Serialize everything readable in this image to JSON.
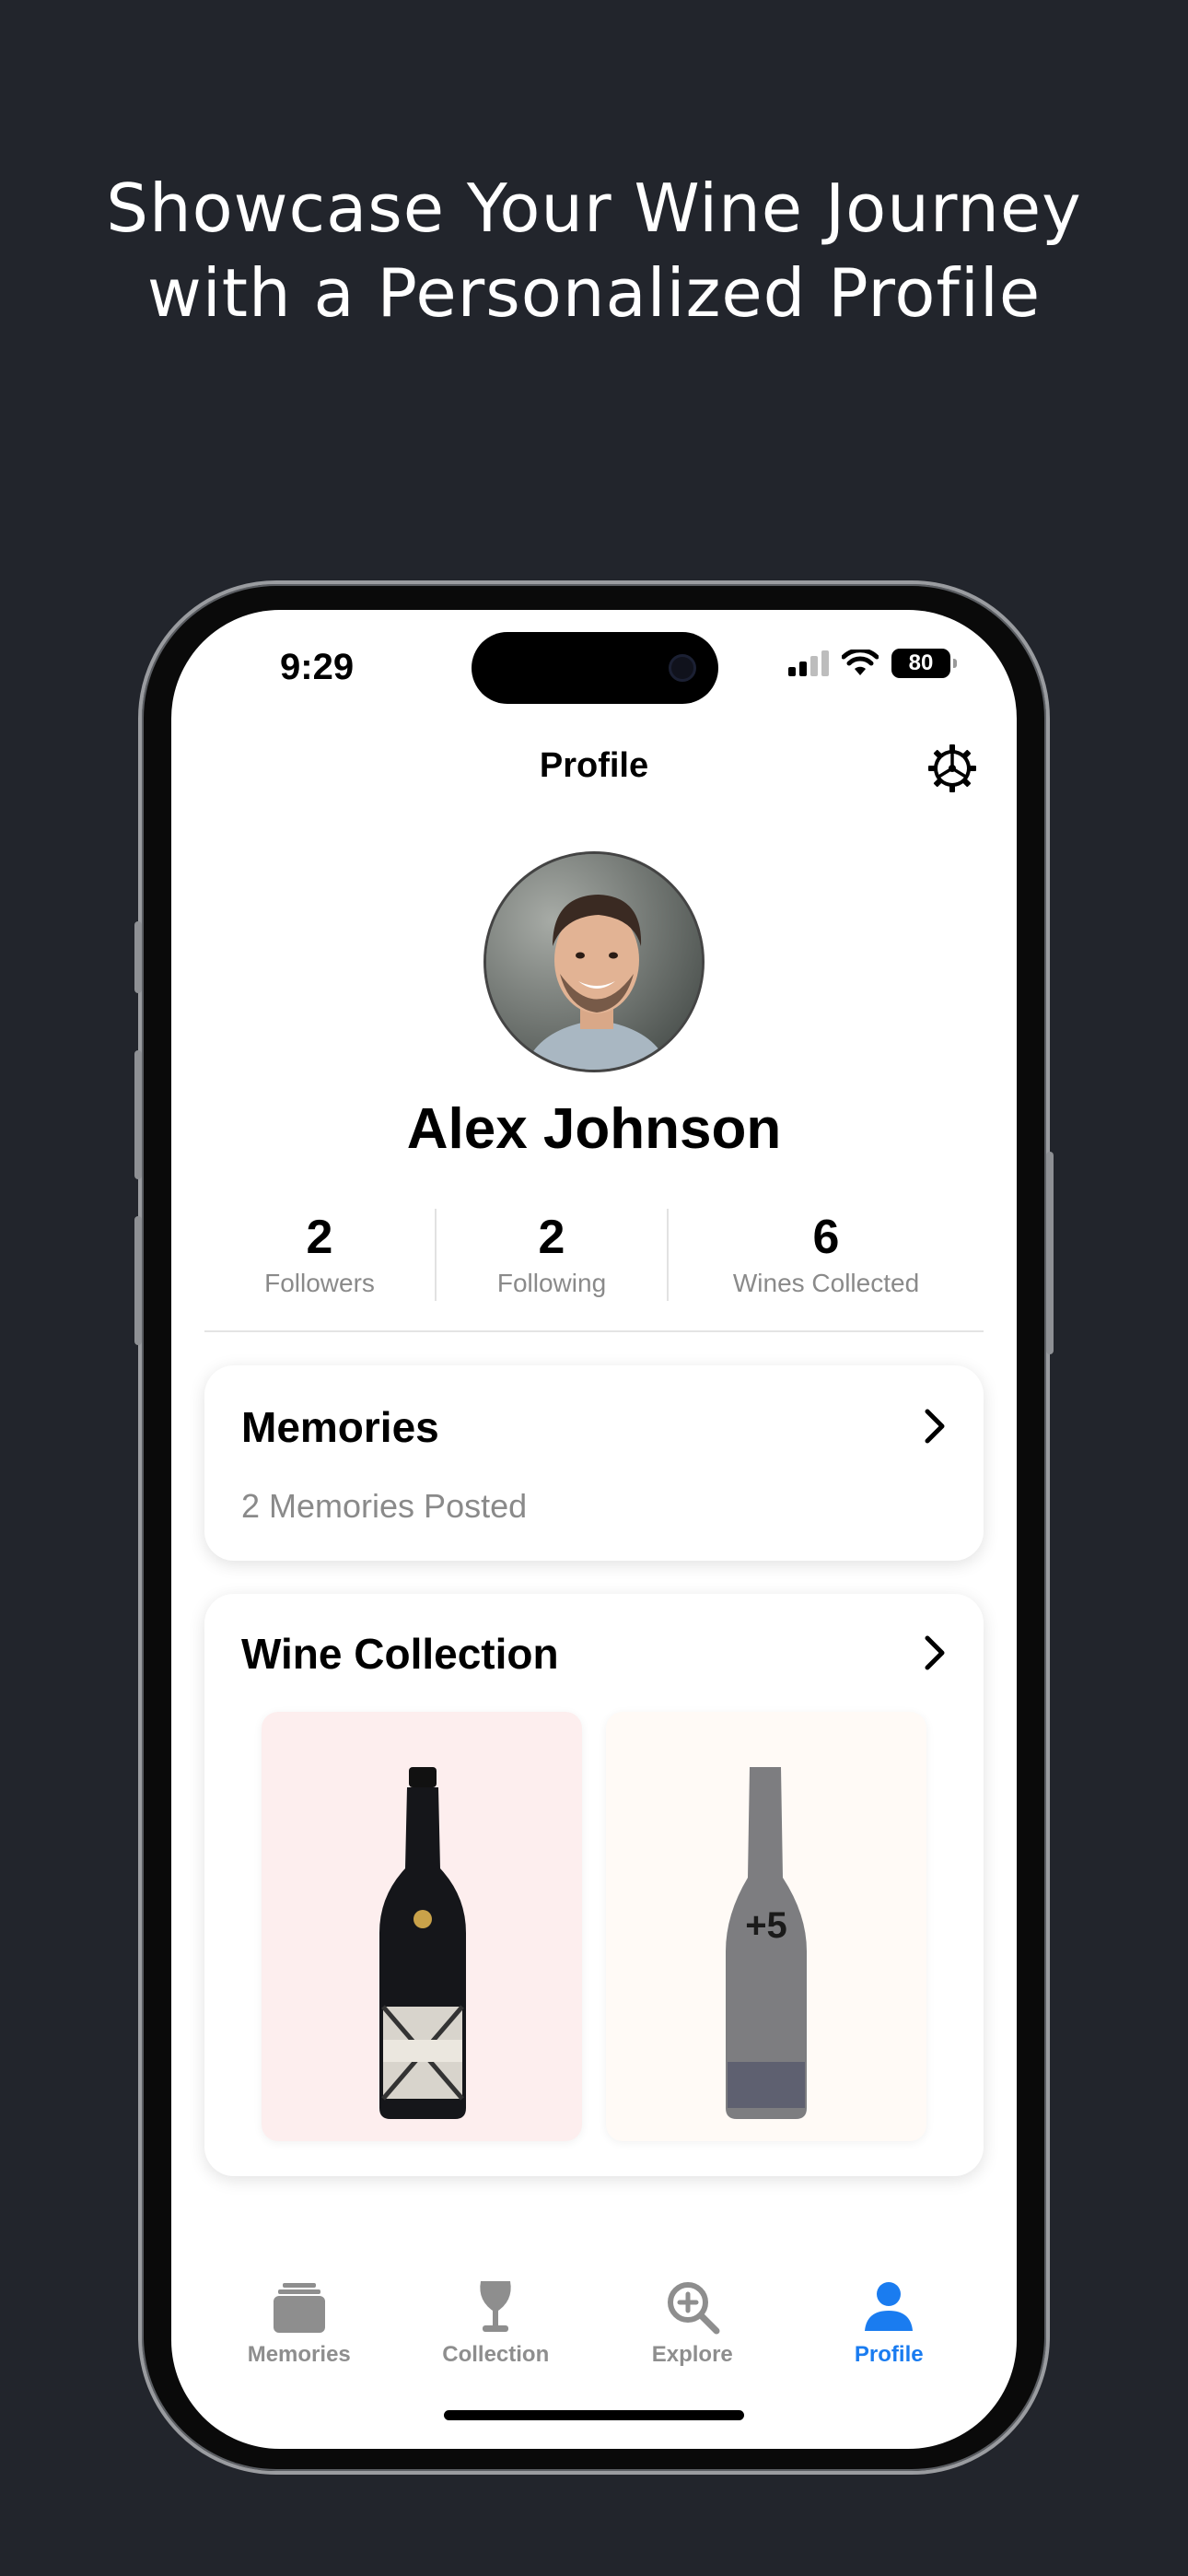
{
  "headline": {
    "line1": "Showcase Your Wine Journey",
    "line2": "with a Personalized Profile"
  },
  "status_bar": {
    "time": "9:29",
    "battery": "80",
    "icons": [
      "cellular-signal-icon",
      "wifi-icon",
      "battery-icon"
    ]
  },
  "nav": {
    "title": "Profile",
    "settings_icon": "gear-icon"
  },
  "profile": {
    "name": "Alex Johnson",
    "stats": [
      {
        "value": "2",
        "label": "Followers"
      },
      {
        "value": "2",
        "label": "Following"
      },
      {
        "value": "6",
        "label": "Wines Collected"
      }
    ]
  },
  "memories_card": {
    "title": "Memories",
    "subtitle": "2 Memories Posted"
  },
  "collection_card": {
    "title": "Wine Collection",
    "more_count": "+5"
  },
  "tabs": [
    {
      "label": "Memories",
      "icon": "memories-stack-icon",
      "active": false
    },
    {
      "label": "Collection",
      "icon": "wine-glass-icon",
      "active": false
    },
    {
      "label": "Explore",
      "icon": "explore-magnifier-icon",
      "active": false
    },
    {
      "label": "Profile",
      "icon": "person-icon",
      "active": true
    }
  ],
  "colors": {
    "background": "#22252c",
    "accent": "#1a7cf0",
    "tile_pink": "#fdeeee",
    "tile_cream": "#fffaf6"
  }
}
